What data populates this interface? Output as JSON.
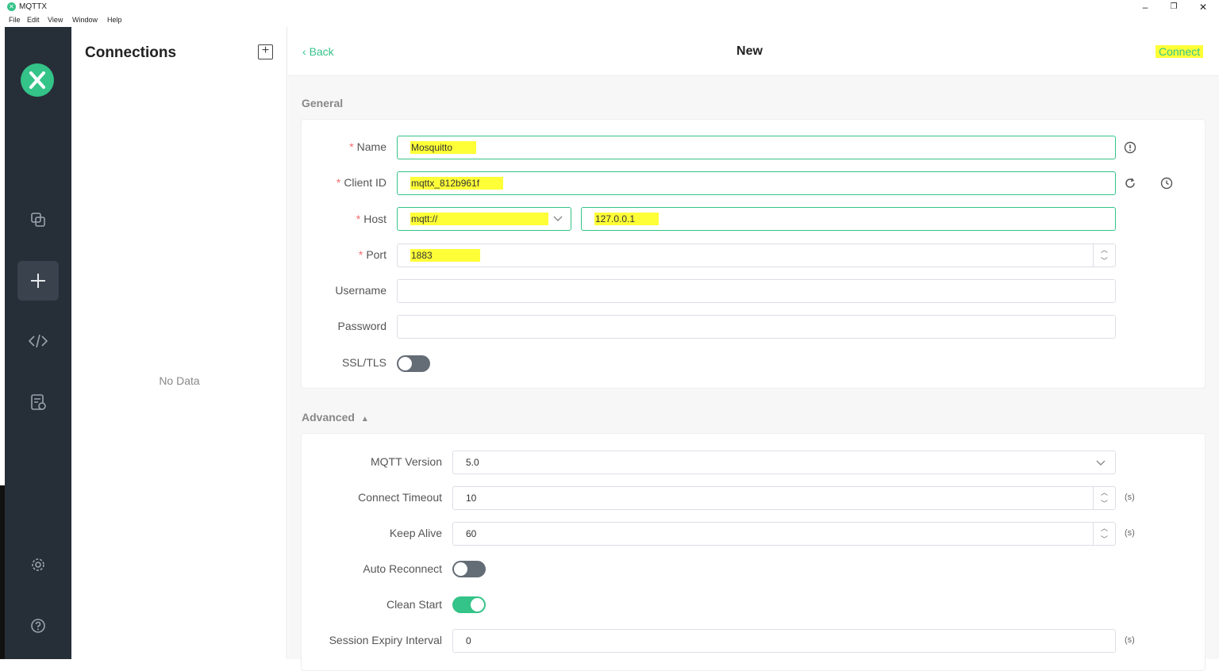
{
  "window": {
    "title": "MQTTX",
    "menu": [
      "File",
      "Edit",
      "View",
      "Window",
      "Help"
    ],
    "controls": {
      "minimize": "–",
      "restore": "❐",
      "close": "✕"
    }
  },
  "connections": {
    "title": "Connections",
    "empty_text": "No Data"
  },
  "header": {
    "back_label": "Back",
    "title": "New",
    "connect_label": "Connect"
  },
  "general": {
    "section_label": "General",
    "name": {
      "label": "Name",
      "value": "Mosquitto"
    },
    "client_id": {
      "label": "Client ID",
      "value": "mqttx_812b961f"
    },
    "host": {
      "label": "Host",
      "protocol": "mqtt://",
      "value": "127.0.0.1"
    },
    "port": {
      "label": "Port",
      "value": "1883"
    },
    "username": {
      "label": "Username",
      "value": ""
    },
    "password": {
      "label": "Password",
      "value": ""
    },
    "ssl": {
      "label": "SSL/TLS",
      "enabled": false
    }
  },
  "advanced": {
    "section_label": "Advanced",
    "mqtt_version": {
      "label": "MQTT Version",
      "value": "5.0"
    },
    "connect_timeout": {
      "label": "Connect Timeout",
      "value": "10",
      "unit": "(s)"
    },
    "keep_alive": {
      "label": "Keep Alive",
      "value": "60",
      "unit": "(s)"
    },
    "auto_reconnect": {
      "label": "Auto Reconnect",
      "enabled": false
    },
    "clean_start": {
      "label": "Clean Start",
      "enabled": true
    },
    "session_expiry": {
      "label": "Session Expiry Interval",
      "value": "0",
      "unit": "(s)"
    }
  },
  "colors": {
    "accent": "#34c388",
    "rail": "#262f38",
    "highlight": "#ffff38"
  }
}
